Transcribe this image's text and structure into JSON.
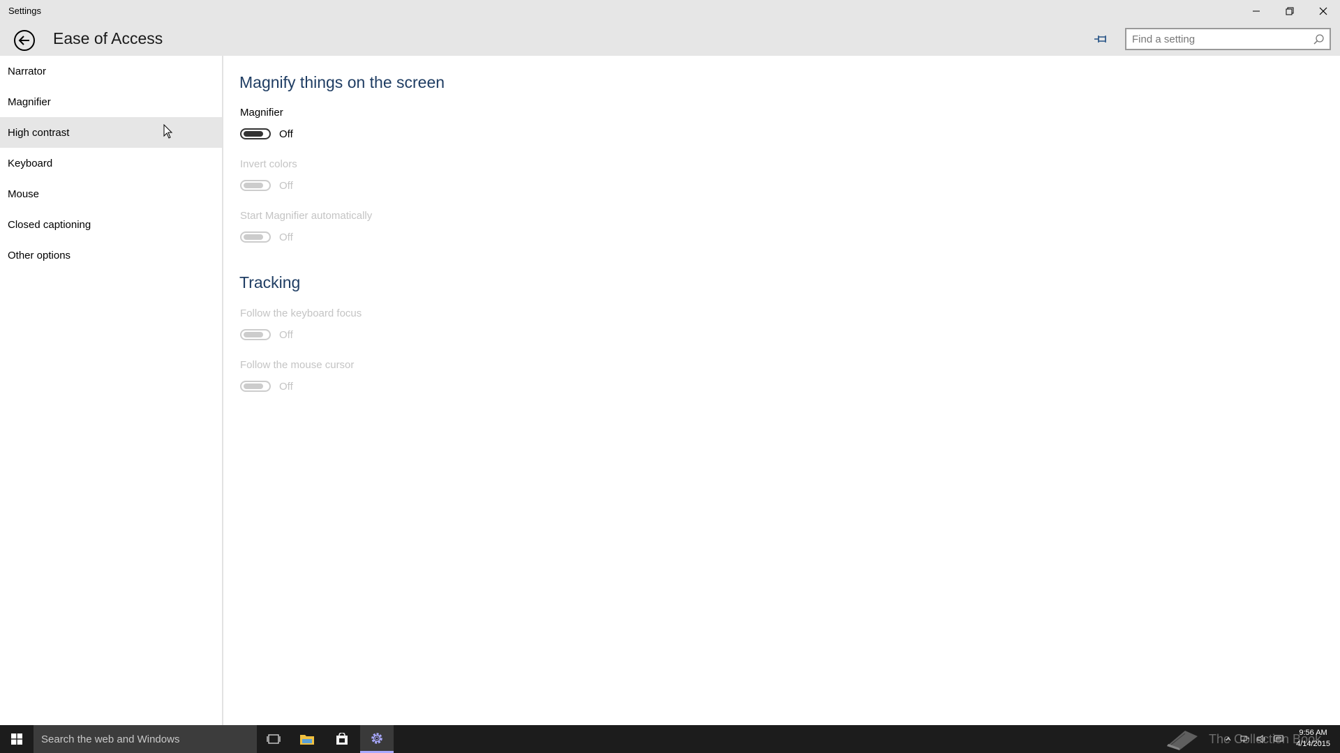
{
  "window": {
    "app_title": "Settings",
    "page_title": "Ease of Access",
    "search_placeholder": "Find a setting"
  },
  "sidebar": {
    "items": [
      {
        "label": "Narrator"
      },
      {
        "label": "Magnifier"
      },
      {
        "label": "High contrast"
      },
      {
        "label": "Keyboard"
      },
      {
        "label": "Mouse"
      },
      {
        "label": "Closed captioning"
      },
      {
        "label": "Other options"
      }
    ],
    "hovered_item": "High contrast"
  },
  "main": {
    "magnify_section_title": "Magnify things on the screen",
    "magnifier": {
      "label": "Magnifier",
      "state": "Off",
      "enabled": true
    },
    "invert_colors": {
      "label": "Invert colors",
      "state": "Off",
      "enabled": false
    },
    "start_auto": {
      "label": "Start Magnifier automatically",
      "state": "Off",
      "enabled": false
    },
    "tracking_section_title": "Tracking",
    "follow_keyboard": {
      "label": "Follow the keyboard focus",
      "state": "Off",
      "enabled": false
    },
    "follow_mouse": {
      "label": "Follow the mouse cursor",
      "state": "Off",
      "enabled": false
    }
  },
  "taskbar": {
    "search_text": "Search the web and Windows",
    "watermark_text": "The Collection Book",
    "time": "9:56 AM",
    "date": "4/14/2015"
  },
  "colors": {
    "titlebar_bg": "#e6e6e6",
    "section_title": "#1f3d63",
    "taskbar_bg": "#1c1c1c",
    "disabled_text": "#c4c4c4"
  }
}
